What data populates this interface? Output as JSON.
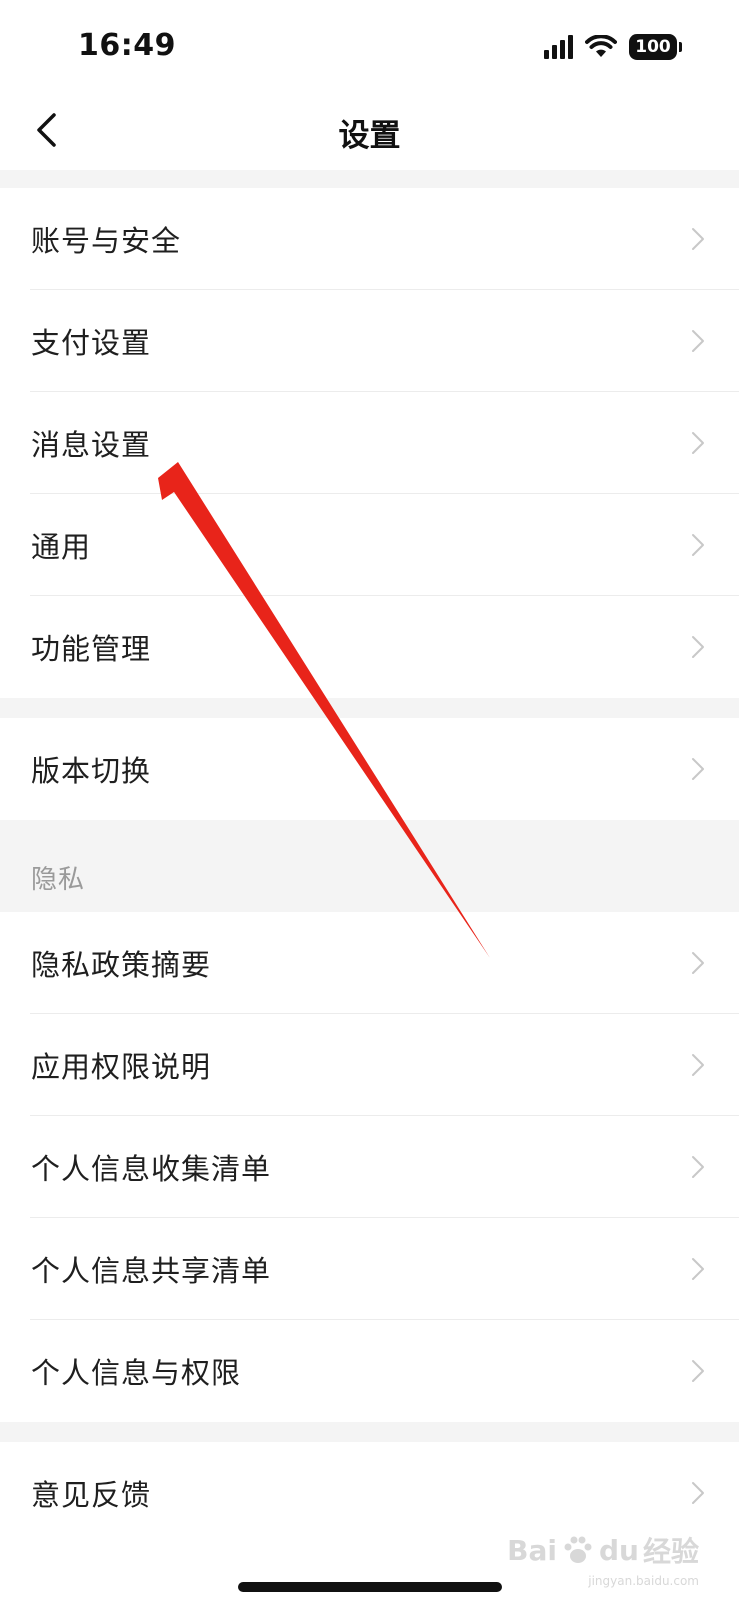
{
  "status_bar": {
    "time": "16:49",
    "battery": "100",
    "icons": [
      "signal-icon",
      "wifi-icon",
      "battery-icon"
    ]
  },
  "nav": {
    "title": "设置",
    "back_icon": "chevron-left-icon"
  },
  "groups": [
    {
      "items": [
        "账号与安全",
        "支付设置",
        "消息设置",
        "通用",
        "功能管理"
      ]
    },
    {
      "items": [
        "版本切换"
      ]
    },
    {
      "header": "隐私",
      "items": [
        "隐私政策摘要",
        "应用权限说明",
        "个人信息收集清单",
        "个人信息共享清单",
        "个人信息与权限"
      ]
    },
    {
      "items": [
        "意见反馈"
      ]
    }
  ],
  "annotation": {
    "color": "#e8241a",
    "points_to": "消息设置"
  },
  "watermark": {
    "brand": "Bai",
    "brand_suffix": "du",
    "product": "经验",
    "domain": "jingyan.baidu.com"
  },
  "colors": {
    "background": "#ffffff",
    "section_gap": "#f4f4f4",
    "text_primary": "#1f1f1f",
    "text_secondary": "#9a9a9a",
    "chevron": "#c8c8c8"
  }
}
